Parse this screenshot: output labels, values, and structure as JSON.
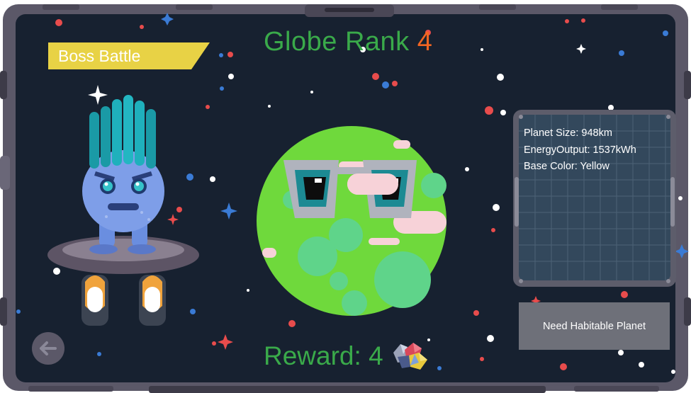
{
  "header": {
    "title_prefix": "Globe Rank",
    "rank": "4"
  },
  "boss_banner": {
    "label": "Boss Battle"
  },
  "planet_info": {
    "size": "Planet Size: 948km",
    "energy": "EnergyOutput: 1537kWh",
    "base_color": "Base Color: Yellow"
  },
  "actions": {
    "need_habitable": "Need Habitable Planet"
  },
  "reward": {
    "label": "Reward:",
    "value": "4"
  },
  "icons": {
    "back": "arrow-left-icon",
    "reward": "crystal-gem-icon",
    "boss": "boss-monster",
    "planet": "planet-with-glasses"
  },
  "colors": {
    "space": "#172130",
    "frame": "#5b5868",
    "title_green": "#3aaa4a",
    "rank_orange": "#f26522",
    "banner_yellow": "#e8d245",
    "planet_green": "#6fd93c",
    "button_gray": "#6e7079",
    "panel_grid": "#33485c"
  }
}
